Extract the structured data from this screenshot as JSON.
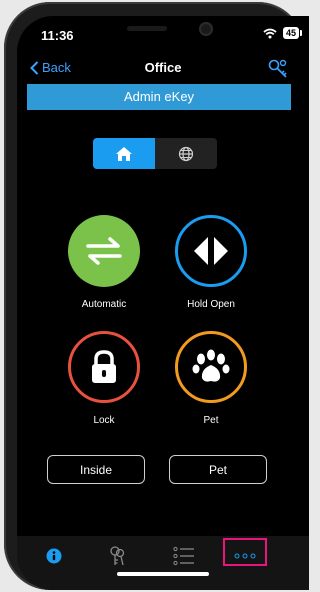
{
  "status": {
    "time": "11:36",
    "battery": "45"
  },
  "nav": {
    "back_label": "Back",
    "title": "Office"
  },
  "banner": {
    "text": "Admin eKey"
  },
  "segmented": {
    "options": [
      "home-icon",
      "globe-icon"
    ],
    "selected": 0
  },
  "modes": [
    {
      "label": "Automatic",
      "icon": "swap-arrows-icon",
      "color": "#7bc24a",
      "filled": true
    },
    {
      "label": "Hold Open",
      "icon": "hold-open-icon",
      "color": "#1a9cf0",
      "filled": false
    },
    {
      "label": "Lock",
      "icon": "lock-icon",
      "color": "#e8513d",
      "filled": false
    },
    {
      "label": "Pet",
      "icon": "paw-icon",
      "color": "#f29b1e",
      "filled": false
    }
  ],
  "buttons": {
    "inside": "Inside",
    "pet": "Pet"
  },
  "tabbar": {
    "items": [
      "info-icon",
      "keys-icon",
      "list-icon",
      "more-icon"
    ],
    "highlighted": "more-icon",
    "accent": "#1a9cf0",
    "highlight_color": "#e8167c"
  }
}
